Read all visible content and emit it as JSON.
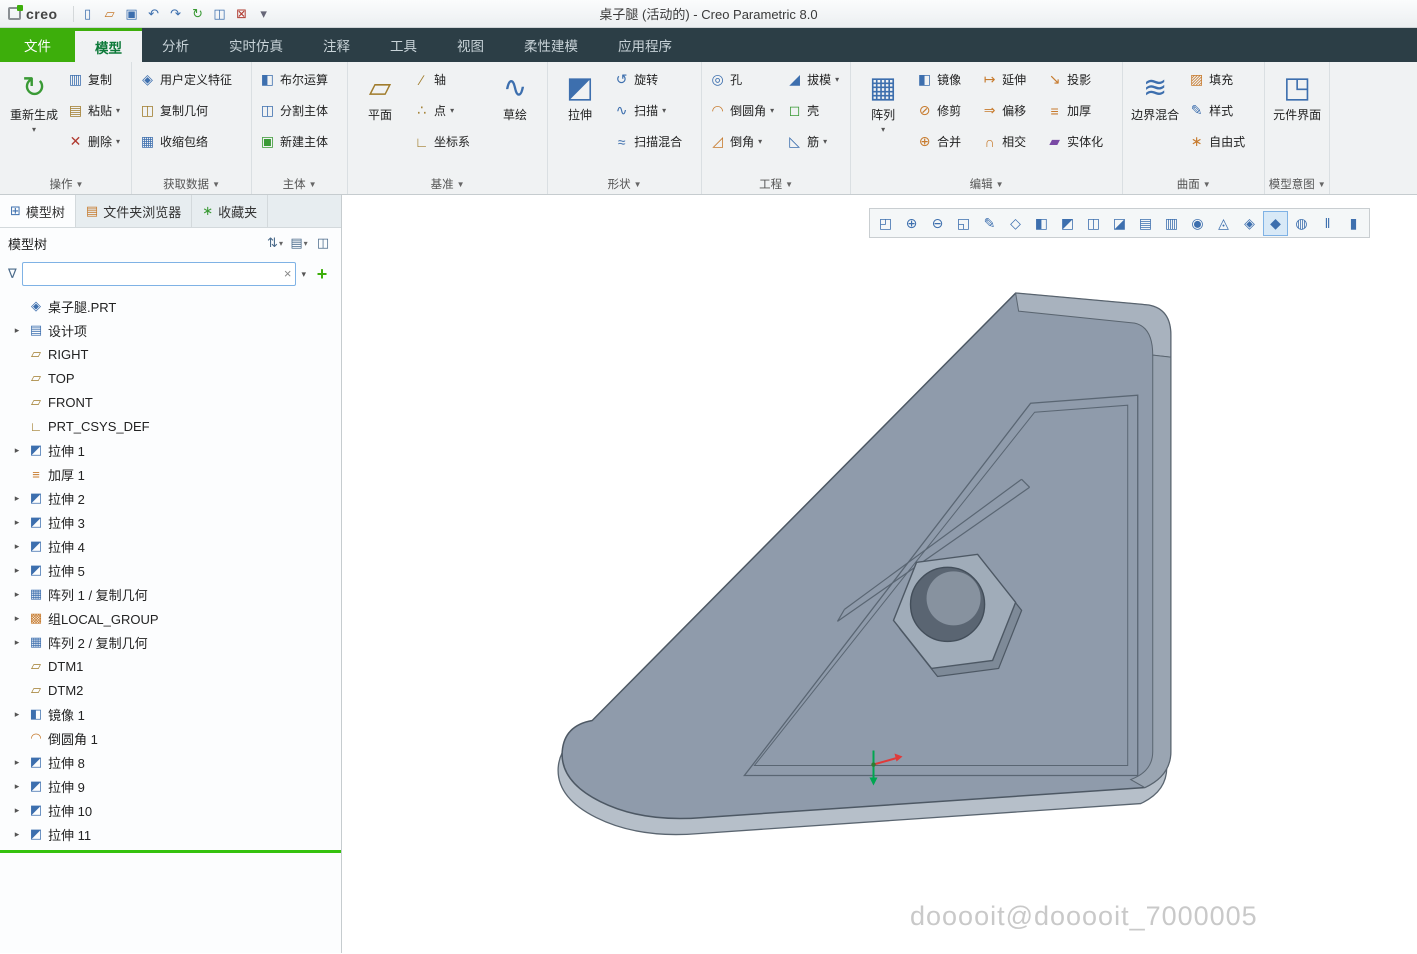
{
  "colors": {
    "accent_green": "#3dae0b",
    "tab_bar": "#2c3e46",
    "model_face": "#8f9bab"
  },
  "titlebar": {
    "logo": "creo",
    "title": "桌子腿 (活动的) - Creo Parametric 8.0",
    "quick_icons": [
      {
        "icon": "new-file-icon",
        "glyph": "▯",
        "cls": "c-blu"
      },
      {
        "icon": "open-file-icon",
        "glyph": "▱",
        "cls": "c-org"
      },
      {
        "icon": "save-icon",
        "glyph": "▣",
        "cls": "c-blu"
      },
      {
        "icon": "undo-icon",
        "glyph": "↶",
        "cls": "c-blu"
      },
      {
        "icon": "redo-icon",
        "glyph": "↷",
        "cls": "c-blu"
      },
      {
        "icon": "regenerate-icon",
        "glyph": "↻",
        "cls": "c-grn"
      },
      {
        "icon": "window-settings-icon",
        "glyph": "◫",
        "cls": "c-blu"
      },
      {
        "icon": "close-window-icon",
        "glyph": "⊠",
        "cls": "c-red"
      },
      {
        "icon": "customize-toolbar-icon",
        "glyph": "▾",
        "cls": "c-gry"
      }
    ]
  },
  "tabs": [
    {
      "label": "文件",
      "cls": "t-file"
    },
    {
      "label": "模型",
      "cls": "t-active"
    },
    {
      "label": "分析",
      "cls": ""
    },
    {
      "label": "实时仿真",
      "cls": ""
    },
    {
      "label": "注释",
      "cls": ""
    },
    {
      "label": "工具",
      "cls": ""
    },
    {
      "label": "视图",
      "cls": ""
    },
    {
      "label": "柔性建模",
      "cls": ""
    },
    {
      "label": "应用程序",
      "cls": ""
    }
  ],
  "ribbon": {
    "groups": [
      {
        "label": "操作",
        "big": [
          {
            "label": "重新生成",
            "glyph": "↻",
            "arrow": "▾"
          }
        ],
        "cols": [
          [
            {
              "label": "复制",
              "icon": "copy-icon",
              "glyph": "▥",
              "arrow": "",
              "cls": "c-blu"
            },
            {
              "label": "粘贴",
              "icon": "paste-icon",
              "glyph": "▤",
              "arrow": "▾",
              "cls": "c-brn"
            },
            {
              "label": "删除",
              "icon": "delete-icon",
              "glyph": "✕",
              "arrow": "▾",
              "cls": "c-red"
            }
          ]
        ]
      },
      {
        "label": "获取数据",
        "big": [],
        "cols": [
          [
            {
              "label": "用户定义特征",
              "icon": "udf-icon",
              "glyph": "◈",
              "arrow": "",
              "cls": "c-blu"
            },
            {
              "label": "复制几何",
              "icon": "copy-geometry-icon",
              "glyph": "◫",
              "arrow": "",
              "cls": "c-brn"
            },
            {
              "label": "收缩包络",
              "icon": "shrinkwrap-icon",
              "glyph": "▦",
              "arrow": "",
              "cls": "c-blu"
            }
          ]
        ]
      },
      {
        "label": "主体",
        "big": [],
        "cols": [
          [
            {
              "label": "布尔运算",
              "icon": "boolean-icon",
              "glyph": "◧",
              "arrow": "",
              "cls": "c-blu"
            },
            {
              "label": "分割主体",
              "icon": "split-body-icon",
              "glyph": "◫",
              "arrow": "",
              "cls": "c-blu"
            },
            {
              "label": "新建主体",
              "icon": "new-body-icon",
              "glyph": "▣",
              "arrow": "",
              "cls": "c-grn"
            }
          ]
        ]
      },
      {
        "label": "基准",
        "big": [
          {
            "label": "平面",
            "glyph": "▱",
            "arrow": ""
          },
          {
            "label": "草绘",
            "glyph": "∿",
            "arrow": ""
          }
        ],
        "cols": [
          [
            {
              "label": "轴",
              "icon": "datum-axis-icon",
              "glyph": "∕",
              "arrow": "",
              "cls": "c-brn"
            },
            {
              "label": "点",
              "icon": "datum-point-icon",
              "glyph": "∴",
              "arrow": "▾",
              "cls": "c-brn"
            },
            {
              "label": "坐标系",
              "icon": "csys-icon",
              "glyph": "∟",
              "arrow": "",
              "cls": "c-brn"
            }
          ]
        ]
      },
      {
        "label": "形状",
        "big": [
          {
            "label": "拉伸",
            "glyph": "◩",
            "arrow": ""
          }
        ],
        "cols": [
          [
            {
              "label": "旋转",
              "icon": "revolve-icon",
              "glyph": "↺",
              "arrow": "",
              "cls": "c-blu"
            },
            {
              "label": "扫描",
              "icon": "sweep-icon",
              "glyph": "∿",
              "arrow": "▾",
              "cls": "c-blu"
            },
            {
              "label": "扫描混合",
              "icon": "swept-blend-icon",
              "glyph": "≈",
              "arrow": "",
              "cls": "c-blu"
            }
          ]
        ]
      },
      {
        "label": "工程",
        "big": [],
        "cols": [
          [
            {
              "label": "孔",
              "icon": "hole-icon",
              "glyph": "◎",
              "arrow": "",
              "cls": "c-blu"
            },
            {
              "label": "倒圆角",
              "icon": "round-icon",
              "glyph": "◠",
              "arrow": "▾",
              "cls": "c-org"
            },
            {
              "label": "倒角",
              "icon": "chamfer-icon",
              "glyph": "◿",
              "arrow": "▾",
              "cls": "c-org"
            }
          ],
          [
            {
              "label": "拔模",
              "icon": "draft-icon",
              "glyph": "◢",
              "arrow": "▾",
              "cls": "c-blu"
            },
            {
              "label": "壳",
              "icon": "shell-icon",
              "glyph": "◻",
              "arrow": "",
              "cls": "c-grn"
            },
            {
              "label": "筋",
              "icon": "rib-icon",
              "glyph": "◺",
              "arrow": "▾",
              "cls": "c-blu"
            }
          ]
        ]
      },
      {
        "label": "编辑",
        "big": [
          {
            "label": "阵列",
            "glyph": "▦",
            "arrow": "▾"
          }
        ],
        "cols": [
          [
            {
              "label": "镜像",
              "icon": "mirror-icon",
              "glyph": "◧",
              "arrow": "",
              "cls": "c-blu"
            },
            {
              "label": "修剪",
              "icon": "trim-icon",
              "glyph": "⊘",
              "arrow": "",
              "cls": "c-org"
            },
            {
              "label": "合并",
              "icon": "merge-icon",
              "glyph": "⊕",
              "arrow": "",
              "cls": "c-org"
            }
          ],
          [
            {
              "label": "延伸",
              "icon": "extend-icon",
              "glyph": "↦",
              "arrow": "",
              "cls": "c-org"
            },
            {
              "label": "偏移",
              "icon": "offset-icon",
              "glyph": "⇒",
              "arrow": "",
              "cls": "c-org"
            },
            {
              "label": "相交",
              "icon": "intersect-icon",
              "glyph": "∩",
              "arrow": "",
              "cls": "c-org"
            }
          ],
          [
            {
              "label": "投影",
              "icon": "project-icon",
              "glyph": "↘",
              "arrow": "",
              "cls": "c-org"
            },
            {
              "label": "加厚",
              "icon": "thicken-icon",
              "glyph": "≡",
              "arrow": "",
              "cls": "c-org"
            },
            {
              "label": "实体化",
              "icon": "solidify-icon",
              "glyph": "▰",
              "arrow": "",
              "cls": "c-mag"
            }
          ]
        ]
      },
      {
        "label": "曲面",
        "big": [
          {
            "label": "边界混合",
            "glyph": "≋",
            "arrow": ""
          }
        ],
        "cols": [
          [
            {
              "label": "填充",
              "icon": "fill-icon",
              "glyph": "▨",
              "arrow": "",
              "cls": "c-org"
            },
            {
              "label": "样式",
              "icon": "style-icon",
              "glyph": "✎",
              "arrow": "",
              "cls": "c-blu"
            },
            {
              "label": "自由式",
              "icon": "freestyle-icon",
              "glyph": "∗",
              "arrow": "",
              "cls": "c-org"
            }
          ]
        ]
      },
      {
        "label": "模型意图",
        "big": [
          {
            "label": "元件界面",
            "glyph": "◳",
            "arrow": ""
          }
        ],
        "cols": []
      }
    ]
  },
  "panel": {
    "tabs": [
      {
        "label": "模型树",
        "icon": "model-tree-icon",
        "glyph": "⊞",
        "cls": "active",
        "icls": "c-blu"
      },
      {
        "label": "文件夹浏览器",
        "icon": "folder-browser-icon",
        "glyph": "▤",
        "cls": "",
        "icls": "c-org"
      },
      {
        "label": "收藏夹",
        "icon": "favorites-icon",
        "glyph": "∗",
        "cls": "",
        "icls": "c-grn"
      }
    ],
    "tree_header": {
      "title": "模型树",
      "icons": [
        {
          "icon": "tree-filter-icon",
          "glyph": "⇅"
        },
        {
          "icon": "tree-display-icon",
          "glyph": "▤"
        },
        {
          "icon": "tree-settings-icon",
          "glyph": "◫"
        }
      ]
    },
    "filter": {
      "value": "",
      "funnel_glyph": "∇",
      "clear_glyph": "×",
      "dropdown_glyph": "▾",
      "add_glyph": "+"
    }
  },
  "tree": {
    "items": [
      {
        "label": "桌子腿.PRT",
        "icon": "part-icon",
        "glyph": "◈",
        "arrow": "",
        "cls": "c-blu"
      },
      {
        "label": "设计项",
        "icon": "design-items-icon",
        "glyph": "▤",
        "arrow": "▸",
        "cls": "c-blu"
      },
      {
        "label": "RIGHT",
        "icon": "datum-plane-icon",
        "glyph": "▱",
        "arrow": "",
        "cls": "c-brn"
      },
      {
        "label": "TOP",
        "icon": "datum-plane-icon",
        "glyph": "▱",
        "arrow": "",
        "cls": "c-brn"
      },
      {
        "label": "FRONT",
        "icon": "datum-plane-icon",
        "glyph": "▱",
        "arrow": "",
        "cls": "c-brn"
      },
      {
        "label": "PRT_CSYS_DEF",
        "icon": "csys-icon",
        "glyph": "∟",
        "arrow": "",
        "cls": "c-brn"
      },
      {
        "label": "拉伸 1",
        "icon": "extrude-icon",
        "glyph": "◩",
        "arrow": "▸",
        "cls": "c-blu"
      },
      {
        "label": "加厚 1",
        "icon": "thicken-icon",
        "glyph": "≡",
        "arrow": "",
        "cls": "c-org"
      },
      {
        "label": "拉伸 2",
        "icon": "extrude-icon",
        "glyph": "◩",
        "arrow": "▸",
        "cls": "c-blu"
      },
      {
        "label": "拉伸 3",
        "icon": "extrude-icon",
        "glyph": "◩",
        "arrow": "▸",
        "cls": "c-blu"
      },
      {
        "label": "拉伸 4",
        "icon": "extrude-icon",
        "glyph": "◩",
        "arrow": "▸",
        "cls": "c-blu"
      },
      {
        "label": "拉伸 5",
        "icon": "extrude-icon",
        "glyph": "◩",
        "arrow": "▸",
        "cls": "c-blu"
      },
      {
        "label": "阵列 1 / 复制几何",
        "icon": "pattern-icon",
        "glyph": "▦",
        "arrow": "▸",
        "cls": "c-blu"
      },
      {
        "label": "组LOCAL_GROUP",
        "icon": "group-icon",
        "glyph": "▩",
        "arrow": "▸",
        "cls": "c-org"
      },
      {
        "label": "阵列 2 / 复制几何",
        "icon": "pattern-icon",
        "glyph": "▦",
        "arrow": "▸",
        "cls": "c-blu"
      },
      {
        "label": "DTM1",
        "icon": "datum-plane-icon",
        "glyph": "▱",
        "arrow": "",
        "cls": "c-brn"
      },
      {
        "label": "DTM2",
        "icon": "datum-plane-icon",
        "glyph": "▱",
        "arrow": "",
        "cls": "c-brn"
      },
      {
        "label": "镜像 1",
        "icon": "mirror-icon",
        "glyph": "◧",
        "arrow": "▸",
        "cls": "c-blu"
      },
      {
        "label": "倒圆角 1",
        "icon": "round-icon",
        "glyph": "◠",
        "arrow": "",
        "cls": "c-org"
      },
      {
        "label": "拉伸 8",
        "icon": "extrude-icon",
        "glyph": "◩",
        "arrow": "▸",
        "cls": "c-blu"
      },
      {
        "label": "拉伸 9",
        "icon": "extrude-icon",
        "glyph": "◩",
        "arrow": "▸",
        "cls": "c-blu"
      },
      {
        "label": "拉伸 10",
        "icon": "extrude-icon",
        "glyph": "◩",
        "arrow": "▸",
        "cls": "c-blu"
      },
      {
        "label": "拉伸 11",
        "icon": "extrude-icon",
        "glyph": "◩",
        "arrow": "▸",
        "cls": "c-blu"
      }
    ]
  },
  "gtoolbar": {
    "icons": [
      {
        "icon": "zoom-region-icon",
        "glyph": "◰",
        "cls": ""
      },
      {
        "icon": "zoom-in-icon",
        "glyph": "⊕",
        "cls": ""
      },
      {
        "icon": "zoom-out-icon",
        "glyph": "⊖",
        "cls": ""
      },
      {
        "icon": "refit-icon",
        "glyph": "◱",
        "cls": ""
      },
      {
        "icon": "repaint-icon",
        "glyph": "✎",
        "cls": "c-org"
      },
      {
        "icon": "saved-orientations-icon",
        "glyph": "◇",
        "cls": ""
      },
      {
        "icon": "display-style-icon",
        "glyph": "◧",
        "cls": "c-gry"
      },
      {
        "icon": "perspective-icon",
        "glyph": "◩",
        "cls": "c-gry"
      },
      {
        "icon": "section-icon",
        "glyph": "◫",
        "cls": "c-gry"
      },
      {
        "icon": "appearance-icon",
        "glyph": "◪",
        "cls": "c-gry"
      },
      {
        "icon": "datum-display-icon",
        "glyph": "▤",
        "cls": ""
      },
      {
        "icon": "annotation-display-icon",
        "glyph": "▥",
        "cls": ""
      },
      {
        "icon": "spin-center-icon",
        "glyph": "◉",
        "cls": ""
      },
      {
        "icon": "orientation-icon",
        "glyph": "◬",
        "cls": ""
      },
      {
        "icon": "selection-options-icon",
        "glyph": "◈",
        "cls": ""
      },
      {
        "icon": "3d-dragger-icon",
        "glyph": "◆",
        "cls": "active"
      },
      {
        "icon": "graphics-alert-icon",
        "glyph": "◍",
        "cls": "c-org"
      },
      {
        "icon": "pause-icon",
        "glyph": "‖",
        "cls": "c-dark"
      },
      {
        "icon": "stop-icon",
        "glyph": "▮",
        "cls": "c-dark"
      }
    ]
  },
  "graphics": {
    "watermark": "dooooit@dooooit_7000005"
  }
}
